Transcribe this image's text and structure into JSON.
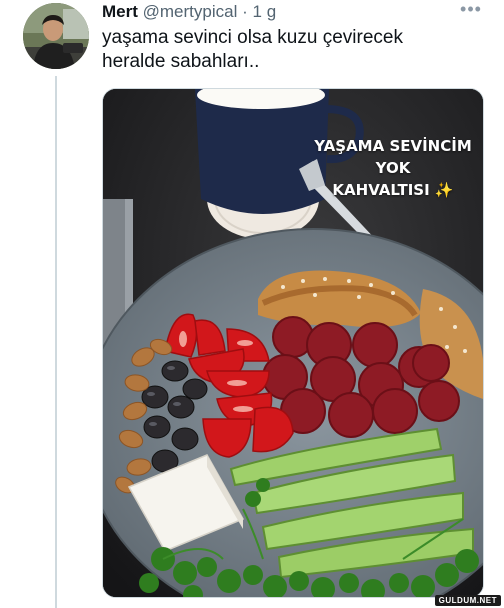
{
  "tweet": {
    "author_name": "Mert",
    "author_handle": "@mertypical",
    "separator": "·",
    "time": "1 g",
    "text": "yaşama sevinci olsa kuzu çevirecek\nheralde sabahları..",
    "more_icon": "more-horizontal-icon"
  },
  "media": {
    "overlay_line1": "YAŞAMA SEVİNCİM YOK",
    "overlay_line2": "KAHVALTISI",
    "overlay_emoji": "✨"
  },
  "watermark": "GULDUM.NET"
}
